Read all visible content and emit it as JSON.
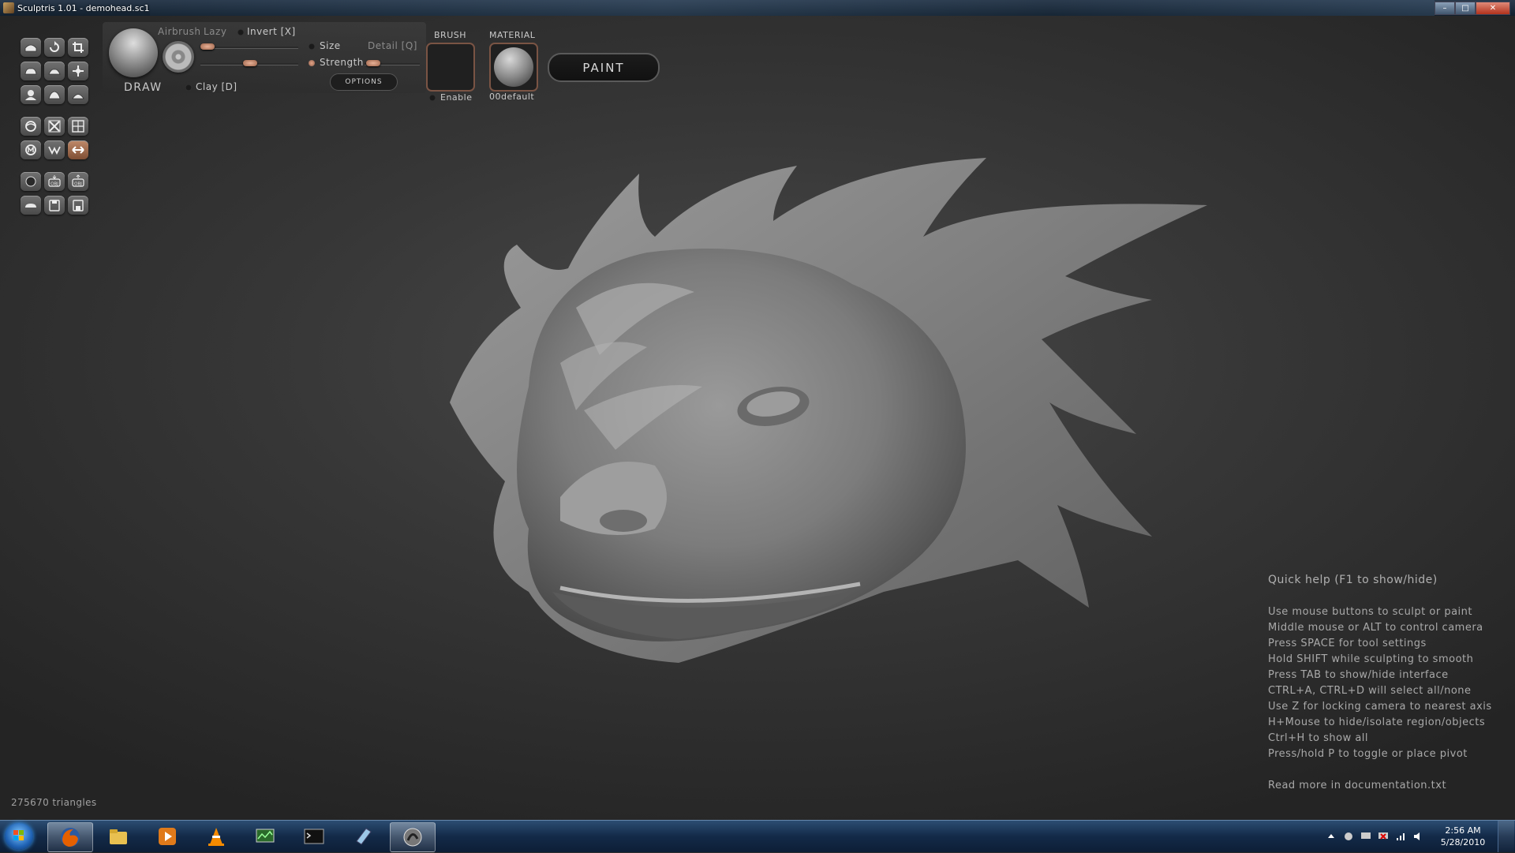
{
  "window": {
    "title": "Sculptris 1.01 - demohead.sc1",
    "controls": [
      "–",
      "□",
      "✕"
    ]
  },
  "tool_palette": {
    "icons": [
      "draw-tool-icon",
      "rotate-tool-icon",
      "crop-tool-icon",
      "inflate-tool-icon",
      "flatten-tool-icon",
      "grab-tool-icon",
      "pinch-tool-icon",
      "smooth-tool-icon",
      "crease-tool-icon",
      "sphere-tool-icon",
      "reduce-tool-icon",
      "grid-tool-icon",
      "mask-tool-icon",
      "wireframe-tool-icon",
      "symmetry-tool-icon",
      "new-sphere-icon",
      "import-obj-icon",
      "export-obj-icon",
      "new-plane-icon",
      "open-file-icon",
      "save-file-icon"
    ]
  },
  "brush_panel": {
    "tool_name": "DRAW",
    "airbrush_label": "Airbrush",
    "lazy_label": "Lazy",
    "invert_label": "Invert [X]",
    "size_label": "Size",
    "detail_label": "Detail [Q]",
    "strength_label": "Strength",
    "clay_label": "Clay [D]",
    "options_label": "OPTIONS",
    "brush_header": "BRUSH",
    "brush_enable_label": "Enable",
    "material_header": "MATERIAL",
    "material_name": "00default",
    "paint_label": "PAINT"
  },
  "quick_help": {
    "title": "Quick help (F1 to show/hide)",
    "lines": [
      "Use mouse buttons to sculpt or paint",
      "Middle mouse or ALT to control camera",
      "Press SPACE for tool settings",
      "Hold SHIFT while sculpting to smooth",
      "Press TAB to show/hide interface",
      "CTRL+A, CTRL+D will select all/none",
      "Use Z for locking camera to nearest axis",
      "H+Mouse to hide/isolate region/objects",
      "Ctrl+H to show all",
      "Press/hold P to toggle or place pivot"
    ],
    "footer": "Read more in documentation.txt"
  },
  "status": {
    "triangles": "275670 triangles"
  },
  "taskbar": {
    "apps": [
      "firefox-icon",
      "explorer-icon",
      "media-player-icon",
      "vlc-icon",
      "task-manager-icon",
      "cmd-icon",
      "notepad-icon",
      "sculptris-icon"
    ],
    "clock_time": "2:56 AM",
    "clock_date": "5/28/2010"
  },
  "colors": {
    "accent": "#c08a6a",
    "viewport_bg": "#373737"
  }
}
